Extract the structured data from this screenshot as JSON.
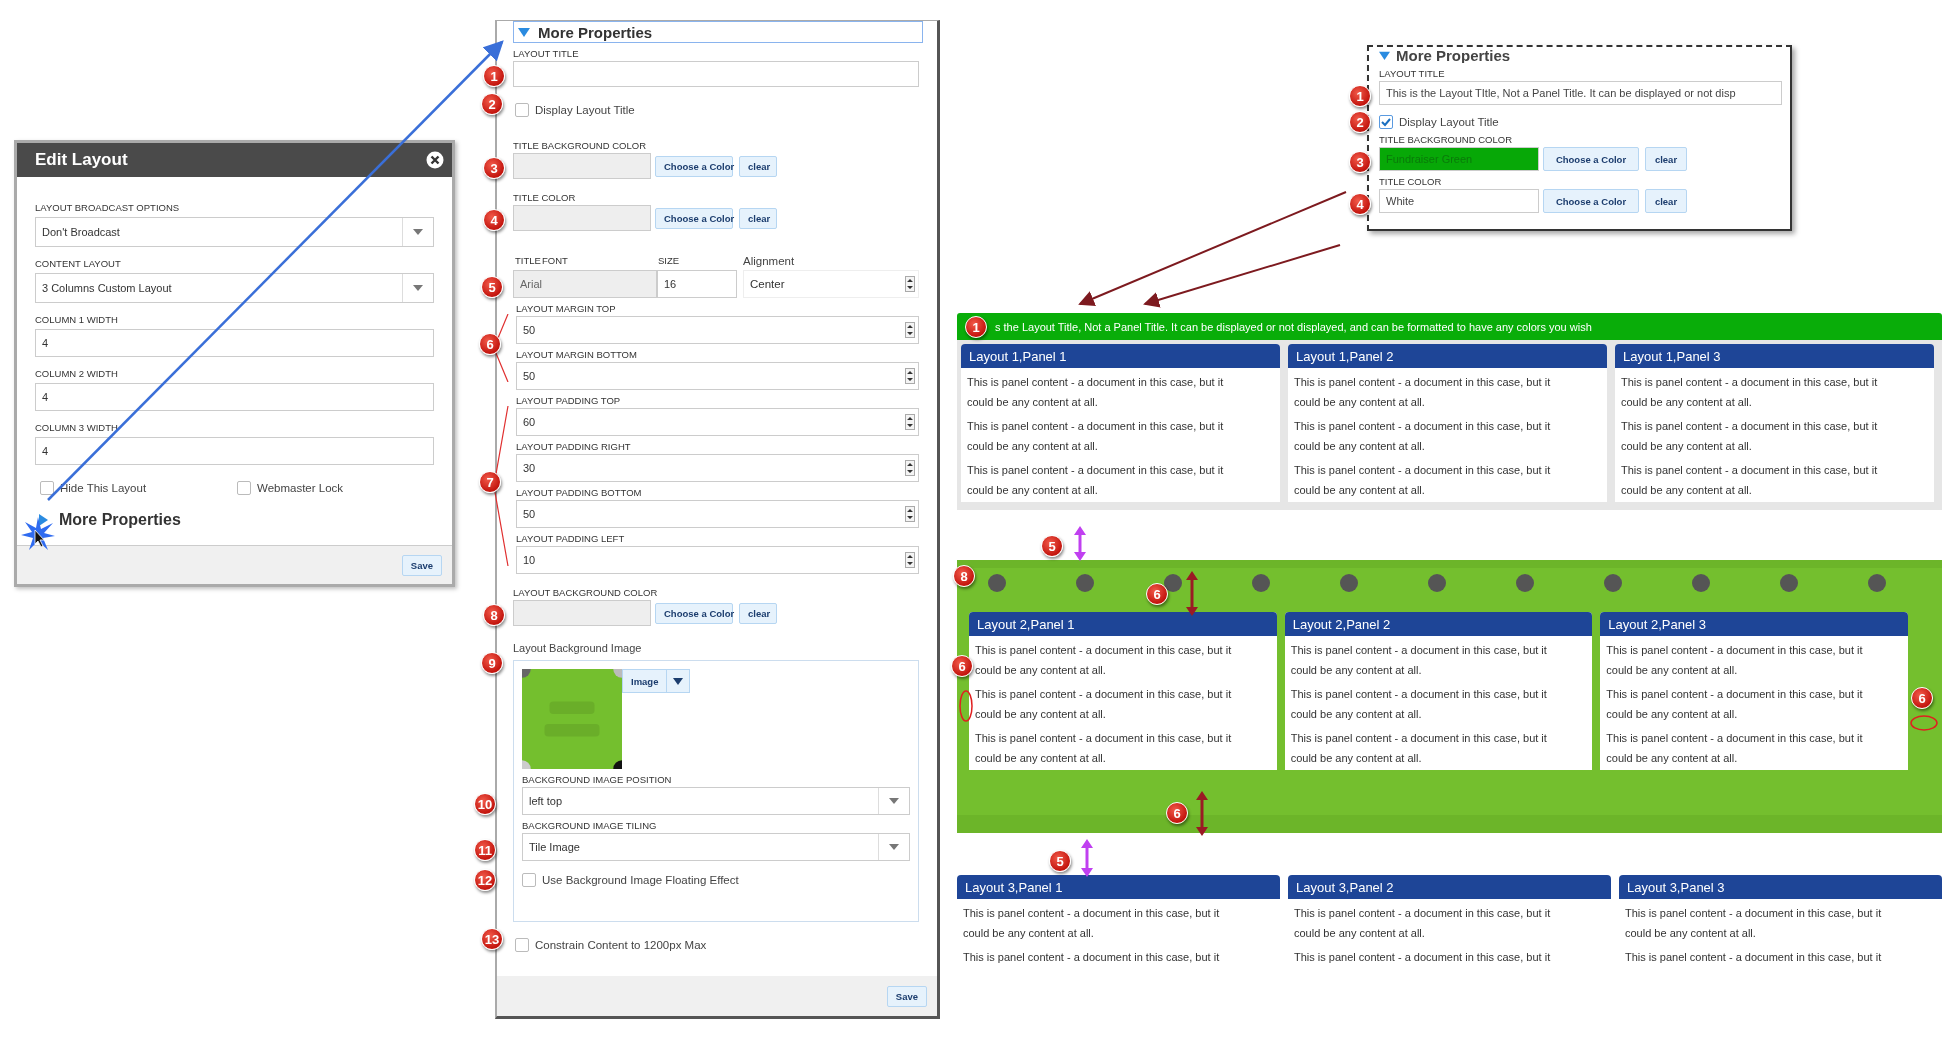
{
  "edit_dialog": {
    "title": "Edit Layout",
    "fields": [
      {
        "label": "LAYOUT BROADCAST OPTIONS",
        "value": "Don't Broadcast",
        "kind": "select"
      },
      {
        "label": "CONTENT LAYOUT",
        "value": "3 Columns Custom Layout",
        "kind": "select"
      },
      {
        "label": "COLUMN 1 WIDTH",
        "value": "4",
        "kind": "text"
      },
      {
        "label": "COLUMN 2 WIDTH",
        "value": "4",
        "kind": "text"
      },
      {
        "label": "COLUMN 3 WIDTH",
        "value": "4",
        "kind": "text"
      }
    ],
    "checkboxes": [
      {
        "label": "Hide This Layout",
        "checked": false
      },
      {
        "label": "Webmaster Lock",
        "checked": false
      }
    ],
    "more_properties": {
      "label": "More Properties",
      "expanded": false
    },
    "save": "Save"
  },
  "properties_panel": {
    "header": {
      "label": "More Properties",
      "expanded": true
    },
    "rows": [
      {
        "kind": "text",
        "marker": "1",
        "label": "LAYOUT TITLE"
      },
      {
        "kind": "checkbox",
        "marker": "2",
        "label": "Display Layout Title",
        "checked": false
      },
      {
        "kind": "color",
        "marker": "3",
        "label": "TITLE BACKGROUND COLOR",
        "buttons": [
          "Choose a Color",
          "clear"
        ]
      },
      {
        "kind": "color",
        "marker": "4",
        "label": "TITLE COLOR",
        "buttons": [
          "Choose a Color",
          "clear"
        ]
      },
      {
        "kind": "font",
        "marker": "5",
        "labels": [
          "TITLE",
          "FONT",
          "SIZE",
          "Alignment"
        ],
        "font": "Arial",
        "size": "16",
        "alignment": "Center"
      },
      {
        "kind": "numbers",
        "marker": "6",
        "fields": [
          {
            "label": "LAYOUT MARGIN TOP",
            "value": "50"
          },
          {
            "label": "LAYOUT MARGIN BOTTOM",
            "value": "50"
          }
        ]
      },
      {
        "kind": "numbers",
        "marker": "7",
        "fields": [
          {
            "label": "LAYOUT PADDING TOP",
            "value": "60"
          },
          {
            "label": "LAYOUT PADDING RIGHT",
            "value": "30"
          },
          {
            "label": "LAYOUT PADDING BOTTOM",
            "value": "50"
          },
          {
            "label": "LAYOUT PADDING LEFT",
            "value": "10"
          }
        ]
      },
      {
        "kind": "color",
        "marker": "8",
        "label": "LAYOUT BACKGROUND COLOR",
        "buttons": [
          "Choose a Color",
          "clear"
        ]
      },
      {
        "marker": "9",
        "label": "Layout Background Image",
        "button": "Image",
        "fields": [
          {
            "kind": "select",
            "marker": "10",
            "label": "BACKGROUND IMAGE POSITION",
            "value": "left top"
          },
          {
            "kind": "select",
            "marker": "11",
            "label": "BACKGROUND IMAGE TILING",
            "value": "Tile Image"
          },
          {
            "kind": "checkbox",
            "marker": "12",
            "label": "Use Background Image Floating Effect",
            "checked": false
          }
        ]
      },
      {
        "kind": "checkbox",
        "marker": "13",
        "label": "Constrain Content to 1200px Max",
        "checked": false
      }
    ],
    "save": "Save"
  },
  "inset": {
    "header": {
      "label": "More Properties",
      "expanded": true
    },
    "rows": [
      {
        "kind": "text",
        "marker": "1",
        "label": "LAYOUT TITLE",
        "value": "This is the Layout TItle, Not a Panel Title. It can be displayed or not disp"
      },
      {
        "kind": "checkbox",
        "marker": "2",
        "label": "Display Layout Title",
        "checked": true
      },
      {
        "kind": "color",
        "marker": "3",
        "label": "TITLE BACKGROUND COLOR",
        "value": "Fundraiser Green",
        "color": "#07a807",
        "buttons": [
          "Choose a Color",
          "clear"
        ]
      },
      {
        "kind": "color",
        "marker": "4",
        "label": "TITLE COLOR",
        "value": "White",
        "buttons": [
          "Choose a Color",
          "clear"
        ]
      }
    ]
  },
  "preview": {
    "layouts": [
      {
        "title": "s the Layout Title, Not a Panel Title. It can be displayed or not displayed, and can be formatted to have any colors you wish",
        "panels": [
          {
            "title": "Layout 1,Panel 1",
            "paragraphs": [
              "This is panel content - a document in this case, but it could be any content at all.",
              "This is panel content - a document in this case, but it could be any content at all.",
              "This is panel content - a document in this case, but it could be any content at all."
            ]
          },
          {
            "title": "Layout 1,Panel 2",
            "paragraphs": [
              "This is panel content - a document in this case, but it could be any content at all.",
              "This is panel content - a document in this case, but it could be any content at all.",
              "This is panel content - a document in this case, but it could be any content at all."
            ]
          },
          {
            "title": "Layout 1,Panel 3",
            "paragraphs": [
              "This is panel content - a document in this case, but it could be any content at all.",
              "This is panel content - a document in this case, but it could be any content at all.",
              "This is panel content - a document in this case, but it could be any content at all."
            ]
          }
        ]
      },
      {
        "background": {
          "kind": "picture"
        },
        "panels": [
          {
            "title": "Layout 2,Panel 1",
            "paragraphs": [
              "This is panel content - a document in this case, but it could be any content at all.",
              "This is panel content - a document in this case, but it could be any content at all.",
              "This is panel content - a document in this case, but it could be any content at all."
            ]
          },
          {
            "title": "Layout 2,Panel 2",
            "paragraphs": [
              "This is panel content - a document in this case, but it could be any content at all.",
              "This is panel content - a document in this case, but it could be any content at all.",
              "This is panel content - a document in this case, but it could be any content at all."
            ]
          },
          {
            "title": "Layout 2,Panel 3",
            "paragraphs": [
              "This is panel content - a document in this case, but it could be any content at all.",
              "This is panel content - a document in this case, but it could be any content at all.",
              "This is panel content - a document in this case, but it could be any content at all."
            ]
          }
        ]
      },
      {
        "panels": [
          {
            "title": "Layout 3,Panel 1",
            "paragraphs": [
              "This is panel content - a document in this case, but it could be any content at all.",
              "This is panel content - a document in this case, but it"
            ]
          },
          {
            "title": "Layout 3,Panel 2",
            "paragraphs": [
              "This is panel content - a document in this case, but it could be any content at all.",
              "This is panel content - a document in this case, but it"
            ]
          },
          {
            "title": "Layout 3,Panel 3",
            "paragraphs": [
              "This is panel content - a document in this case, but it could be any content at all.",
              "This is panel content - a document in this case, but it"
            ]
          }
        ]
      }
    ],
    "markers": [
      "1",
      "5",
      "8",
      "6",
      "6",
      "6",
      "6",
      "5"
    ]
  }
}
